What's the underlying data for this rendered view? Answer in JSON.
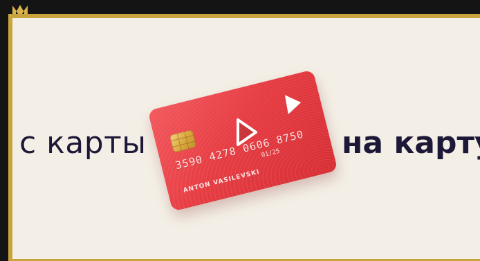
{
  "banner": {
    "text_from": "с карты",
    "text_to": "на карту"
  },
  "card": {
    "number": "3590 4278 0606 8750",
    "expiry": "01/25",
    "holder": "ANTON VASILEVSKI"
  },
  "video": {
    "play_icon": "play-icon"
  },
  "colors": {
    "frame_border": "#c9a43c",
    "background": "#f4efe6",
    "text": "#1e1838",
    "card_red": "#e63d43",
    "outer_bg": "#141414"
  }
}
